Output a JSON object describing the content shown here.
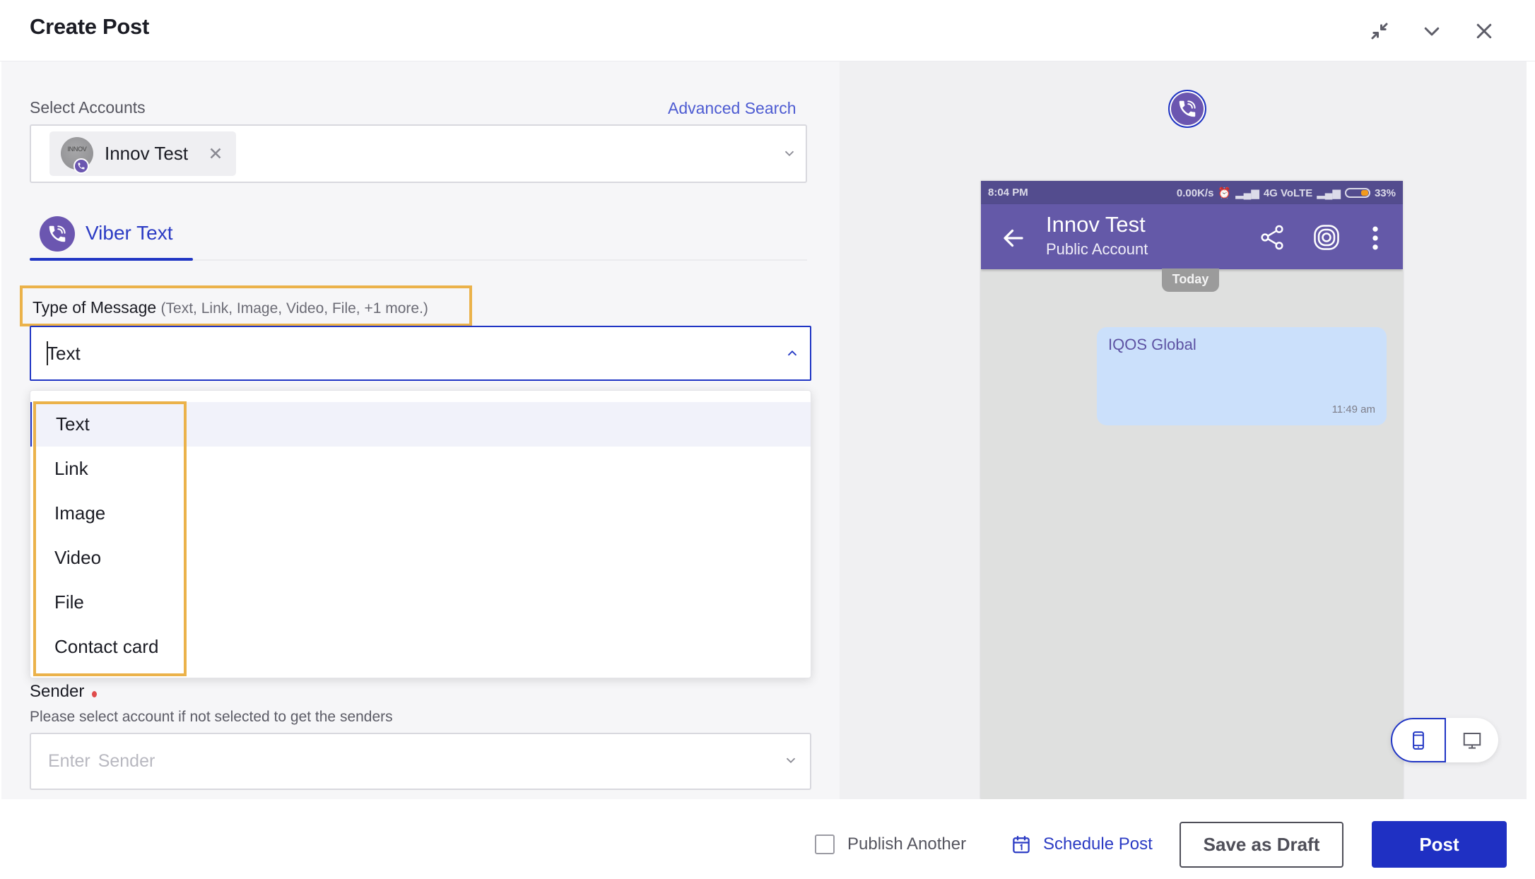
{
  "header": {
    "title": "Create Post",
    "icons": [
      "collapse-icon",
      "chevron-down-icon",
      "close-icon"
    ]
  },
  "accounts": {
    "label": "Select Accounts",
    "advanced_search": "Advanced Search",
    "selected": [
      {
        "name": "Innov Test",
        "avatar_text": "INNOV",
        "network": "viber"
      }
    ]
  },
  "tabs": [
    {
      "label": "Viber Text",
      "icon": "viber-icon",
      "active": true
    }
  ],
  "message_type": {
    "label": "Type of Message",
    "hint": "(Text, Link, Image, Video, File, +1 more.)",
    "value": "Text",
    "options": [
      "Text",
      "Link",
      "Image",
      "Video",
      "File",
      "Contact card"
    ],
    "selected_index": 0
  },
  "sender": {
    "label": "Sender",
    "required": true,
    "help": "Please select account if not selected to get the senders",
    "placeholder": "Enter  Sender"
  },
  "preview": {
    "status_bar": {
      "time": "8:04 PM",
      "speed": "0.00K/s",
      "network": "4G VoLTE",
      "battery": "33%"
    },
    "contact_name": "Innov Test",
    "contact_subtitle": "Public Account",
    "date_label": "Today",
    "message": {
      "text": "IQOS Global",
      "time": "11:49 am"
    },
    "device_modes": [
      "mobile",
      "desktop"
    ],
    "active_device": "mobile"
  },
  "footer": {
    "publish_another": "Publish Another",
    "publish_another_checked": false,
    "schedule_post": "Schedule Post",
    "save_draft": "Save as Draft",
    "post": "Post"
  },
  "colors": {
    "primary": "#1f30c3",
    "viber": "#6b56b0",
    "highlight": "#ebb24a",
    "required": "#e04c4c"
  }
}
